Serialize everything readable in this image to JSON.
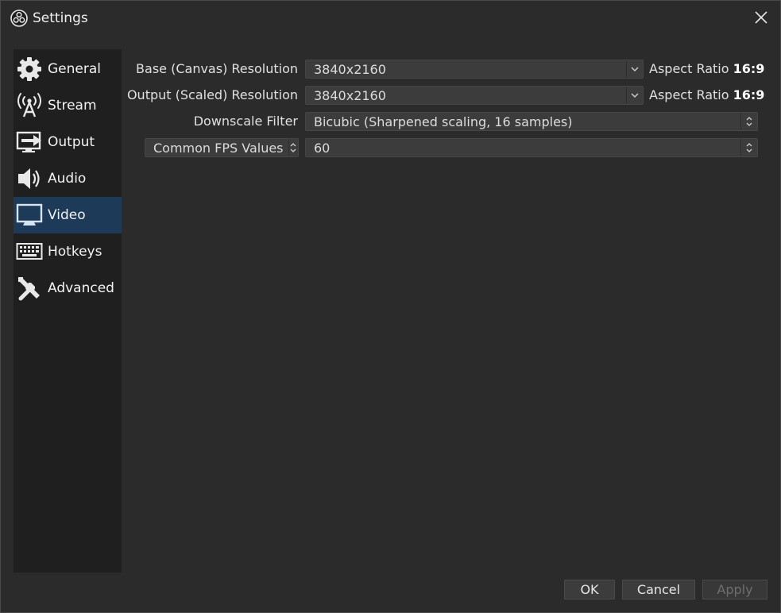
{
  "window": {
    "title": "Settings"
  },
  "sidebar": {
    "items": [
      {
        "label": "General",
        "icon": "gear-icon",
        "active": false
      },
      {
        "label": "Stream",
        "icon": "antenna-icon",
        "active": false
      },
      {
        "label": "Output",
        "icon": "output-monitor-icon",
        "active": false
      },
      {
        "label": "Audio",
        "icon": "speaker-icon",
        "active": false
      },
      {
        "label": "Video",
        "icon": "monitor-icon",
        "active": true
      },
      {
        "label": "Hotkeys",
        "icon": "keyboard-icon",
        "active": false
      },
      {
        "label": "Advanced",
        "icon": "tools-icon",
        "active": false
      }
    ]
  },
  "video": {
    "base_resolution": {
      "label": "Base (Canvas) Resolution",
      "value": "3840x2160",
      "aspect_label": "Aspect Ratio",
      "aspect_value": "16:9"
    },
    "output_resolution": {
      "label": "Output (Scaled) Resolution",
      "value": "3840x2160",
      "aspect_label": "Aspect Ratio",
      "aspect_value": "16:9"
    },
    "downscale_filter": {
      "label": "Downscale Filter",
      "value": "Bicubic (Sharpened scaling, 16 samples)"
    },
    "fps": {
      "type_value": "Common FPS Values",
      "value": "60"
    }
  },
  "buttons": {
    "ok": "OK",
    "cancel": "Cancel",
    "apply": "Apply"
  },
  "colors": {
    "active_item": "#1d3a58",
    "background": "#2b2b2b",
    "sidebar": "#1f1f1f"
  }
}
